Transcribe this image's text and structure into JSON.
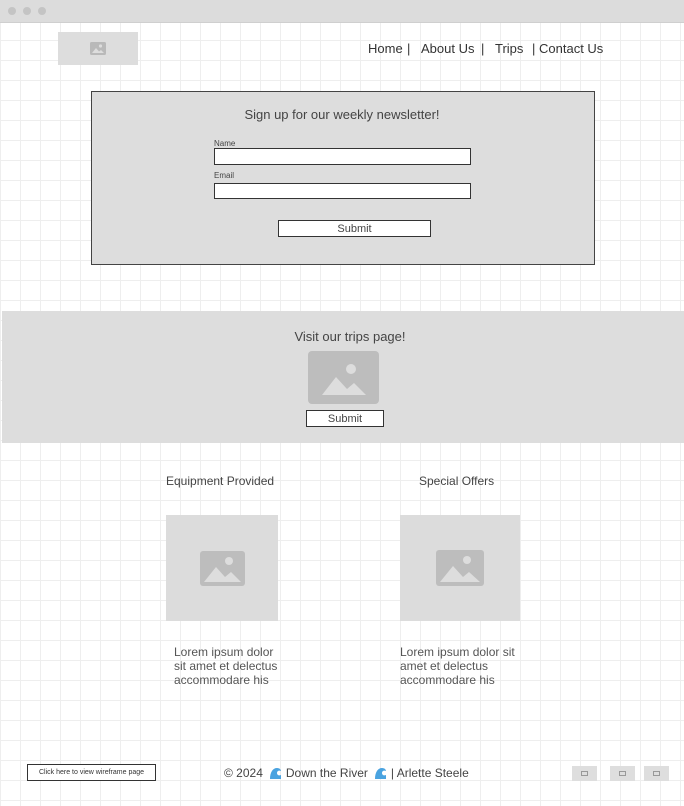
{
  "nav": {
    "home": "Home",
    "about": "About Us",
    "trips": "Trips",
    "contact": "Contact Us"
  },
  "newsletter": {
    "title": "Sign up for our weekly newsletter!",
    "name_label": "Name",
    "email_label": "Email",
    "name_value": "",
    "email_value": "",
    "submit_label": "Submit"
  },
  "trips_band": {
    "title": "Visit our trips page!",
    "submit_label": "Submit"
  },
  "features": {
    "equipment": {
      "title": "Equipment Provided",
      "text": "Lorem ipsum dolor sit amet et delectus accommodare his"
    },
    "offers": {
      "title": "Special Offers",
      "text": "Lorem ipsum dolor sit amet et delectus accommodare his"
    }
  },
  "footer": {
    "wireframe_link": "Click here to view wireframe page",
    "copyright": "© 2024",
    "brand": "Down the River",
    "author": "| Arlette Steele"
  },
  "icons": {
    "logo": "image-placeholder-icon",
    "wave": "wave-icon",
    "social": "social-icon"
  },
  "colors": {
    "placeholder_gray": "#dddddd",
    "wave_blue": "#4aa3e0"
  }
}
